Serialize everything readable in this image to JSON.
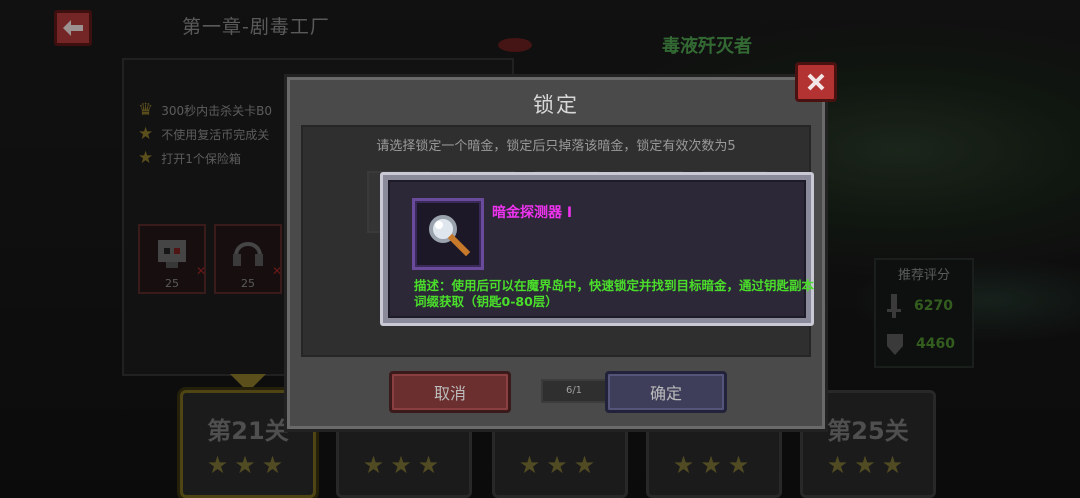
{
  "header": {
    "chapter_title": "第一章-剧毒工厂",
    "boss_name": "毒液歼灭者"
  },
  "tasks": [
    {
      "icon": "crown-icon",
      "text": "300秒内击杀关卡B0"
    },
    {
      "icon": "star-icon",
      "text": "不使用复活币完成关"
    },
    {
      "icon": "star-icon",
      "text": "打开1个保险箱"
    }
  ],
  "rewards": [
    {
      "icon": "skull-helmet-icon",
      "count": "25"
    },
    {
      "icon": "headphones-icon",
      "count": "25"
    }
  ],
  "score": {
    "title": "推荐评分",
    "attack": "6270",
    "defense": "4460"
  },
  "levels": [
    {
      "name": "第21关",
      "stars": "★★★"
    },
    {
      "name": "",
      "stars": "★★★"
    },
    {
      "name": "",
      "stars": "★★★"
    },
    {
      "name": "",
      "stars": "★★★"
    },
    {
      "name": "第25关",
      "stars": "★★★"
    }
  ],
  "lock_dialog": {
    "title": "锁定",
    "description": "请选择锁定一个暗金，锁定后只掉落该暗金，锁定有效次数为5",
    "page": "6/1",
    "cancel_label": "取消",
    "confirm_label": "确定"
  },
  "tooltip": {
    "item_name": "暗金探测器 I",
    "item_icon": "magnifier-icon",
    "item_description": "描述：使用后可以在魔界岛中，快速锁定并找到目标暗金，通过钥匙副本词缀获取（钥匙0-80层）"
  },
  "colors": {
    "tooltip_name": "#ee33ee",
    "tooltip_desc": "#4ade2a",
    "close_button": "#b33333"
  }
}
